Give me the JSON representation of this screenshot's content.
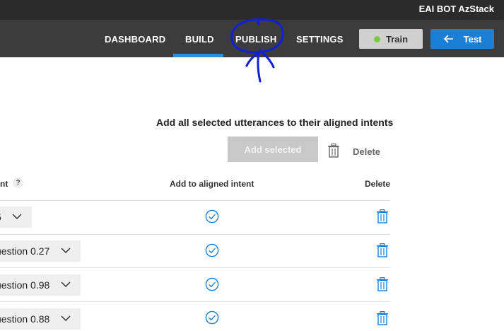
{
  "app": {
    "title": "EAI BOT AzStack"
  },
  "nav": {
    "items": [
      {
        "label": "DASHBOARD"
      },
      {
        "label": "BUILD"
      },
      {
        "label": "PUBLISH"
      },
      {
        "label": "SETTINGS"
      }
    ],
    "active": "BUILD",
    "train_label": "Train",
    "test_label": "Test"
  },
  "actions": {
    "heading": "Add all selected utterances to their aligned intents",
    "add_selected_label": "Add selected",
    "delete_label": "Delete"
  },
  "table": {
    "columns": {
      "intent": "nt",
      "help": "?",
      "add_to_aligned": "Add to aligned intent",
      "delete": "Delete"
    },
    "rows": [
      {
        "intent": "5"
      },
      {
        "intent": "uestion 0.27"
      },
      {
        "intent": "uestion 0.98"
      },
      {
        "intent": "uestion 0.88"
      }
    ]
  },
  "colors": {
    "nav_bg": "#3c3c3c",
    "top_bg": "#2b2b2b",
    "accent": "#1b7fd6",
    "underline": "#2e8ed9",
    "train_status": "#7ac943",
    "annotation": "#1020d8"
  }
}
